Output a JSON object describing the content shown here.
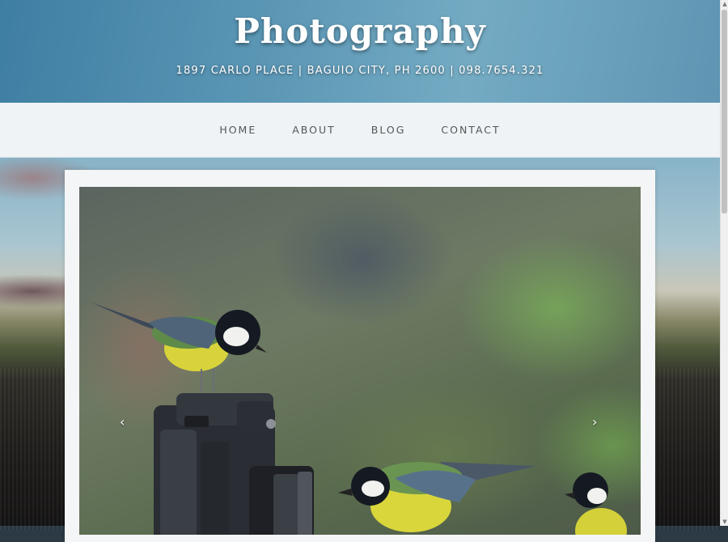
{
  "header": {
    "title": "Photography",
    "address": "1897 CARLO PLACE | BAGUIO CITY, PH 2600 | 098.7654.321"
  },
  "nav": {
    "items": [
      "HOME",
      "ABOUT",
      "BLOG",
      "CONTACT"
    ]
  },
  "slider": {
    "prev_label": "‹",
    "next_label": "›"
  },
  "colors": {
    "header": "#5d98b6",
    "nav_background": "#eff3f6",
    "nav_text": "#555555",
    "frame": "#f4f5f6"
  }
}
